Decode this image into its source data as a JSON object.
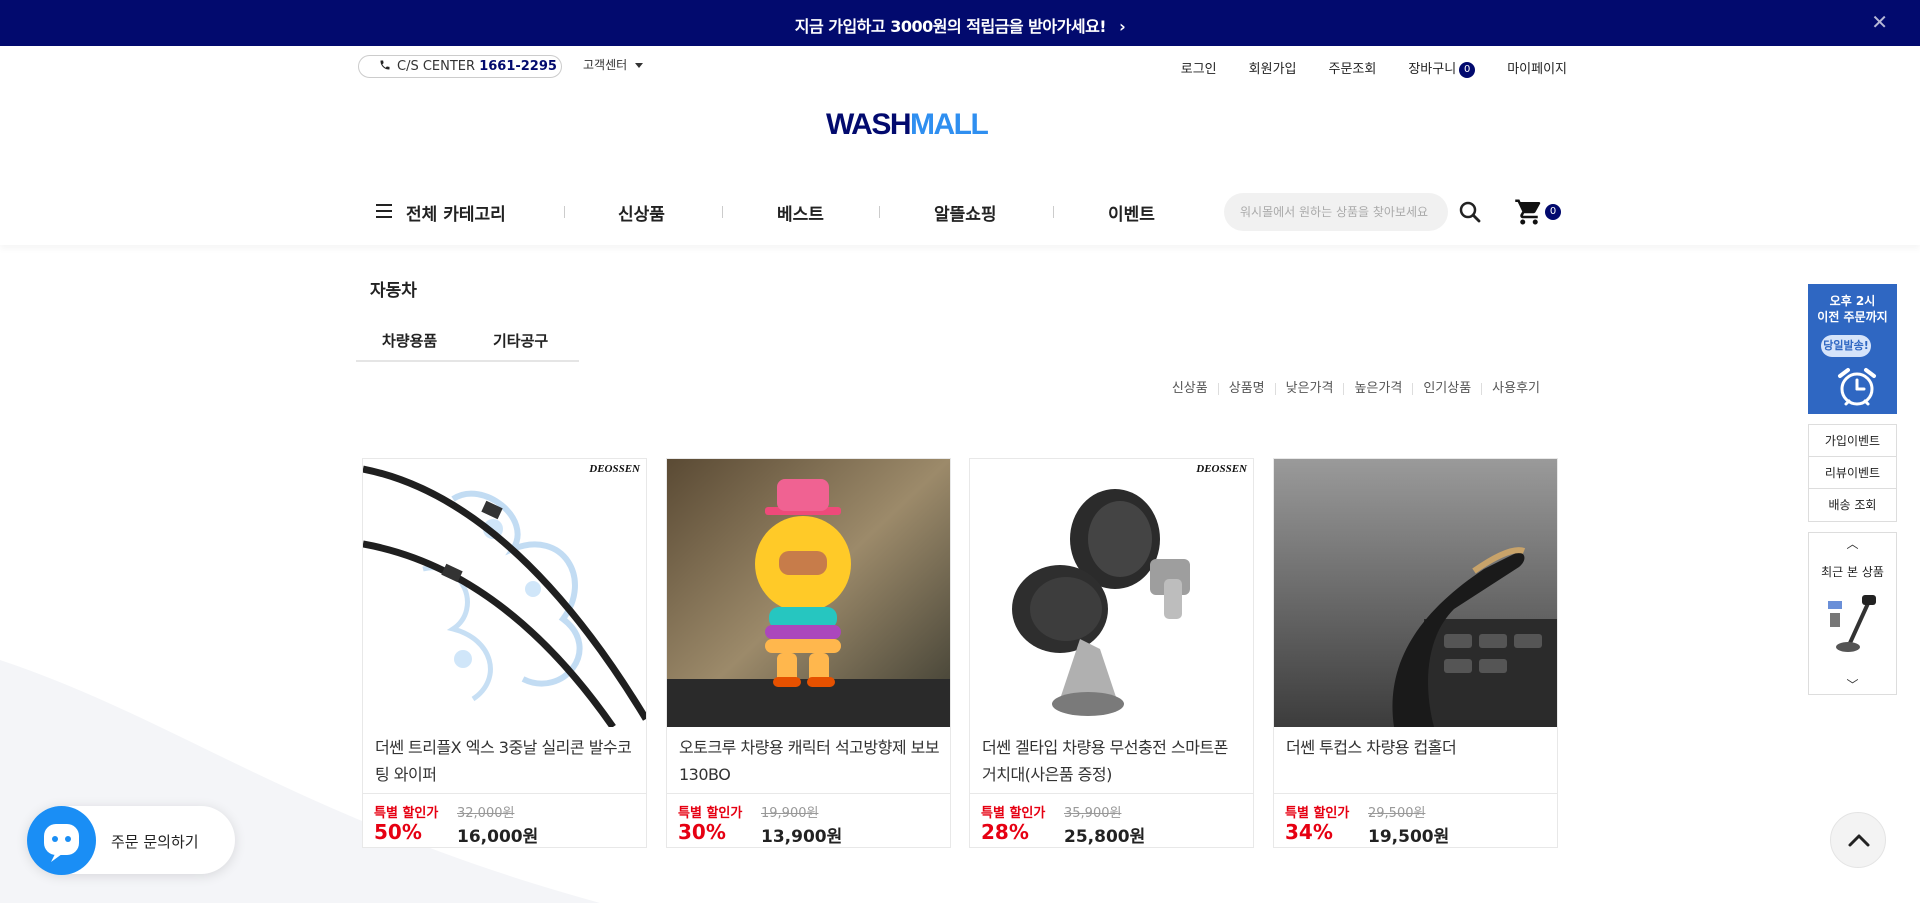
{
  "promo_banner": {
    "message": "지금 가입하고 3000원의 적립금을 받아가세요!",
    "arrow": "›",
    "close": "✕"
  },
  "util_bar": {
    "cs_label": "C/S CENTER",
    "cs_phone": "1661-2295",
    "customer_center": "고객센터",
    "links": {
      "login": "로그인",
      "signup": "회원가입",
      "order_lookup": "주문조회",
      "cart": "장바구니",
      "cart_count": "0",
      "mypage": "마이페이지"
    }
  },
  "logo": {
    "part1": "WASH",
    "part2": "MALL"
  },
  "nav": {
    "all_categories": "전체 카테고리",
    "items": [
      "신상품",
      "베스트",
      "알뜰쇼핑",
      "이벤트"
    ],
    "search_placeholder": "워시몰에서 원하는 상품을 찾아보세요",
    "cart_count": "0"
  },
  "category": {
    "title": "자동차",
    "subtabs": [
      "차량용품",
      "기타공구"
    ]
  },
  "sort_options": [
    "신상품",
    "상품명",
    "낮은가격",
    "높은가격",
    "인기상품",
    "사용후기"
  ],
  "products": [
    {
      "brand": "DEOSSEN",
      "name": "더쎈 트리플X 엑스 3중날 실리콘 발수코팅 와이퍼",
      "sale_label": "특별 할인가",
      "original_price": "32,000원",
      "discount": "50%",
      "price": "16,000원"
    },
    {
      "brand": "",
      "name": "오토크루 차량용 캐릭터 석고방향제 보보130BO",
      "sale_label": "특별 할인가",
      "original_price": "19,900원",
      "discount": "30%",
      "price": "13,900원"
    },
    {
      "brand": "DEOSSEN",
      "name": "더쎈 겔타입 차량용 무선충전 스마트폰 거치대(사은품 증정)",
      "sale_label": "특별 할인가",
      "original_price": "35,900원",
      "discount": "28%",
      "price": "25,800원"
    },
    {
      "brand": "",
      "name": "더쎈 투컵스 차량용 컵홀더",
      "sale_label": "특별 할인가",
      "original_price": "29,500원",
      "discount": "34%",
      "price": "19,500원"
    }
  ],
  "right_panel": {
    "promo_line1": "오후 2시",
    "promo_line2": "이전 주문까지",
    "promo_pill": "당일발송!",
    "links": [
      "가입이벤트",
      "리뷰이벤트",
      "배송 조회"
    ],
    "recent_label": "최근 본 상품"
  },
  "chat": {
    "label": "주문 문의하기"
  },
  "colors": {
    "navy": "#020a6e",
    "accent_blue": "#2f8ff0",
    "sale_red": "#e60012",
    "panel_blue": "#2f67c2",
    "chat_blue": "#1a8ef5"
  }
}
